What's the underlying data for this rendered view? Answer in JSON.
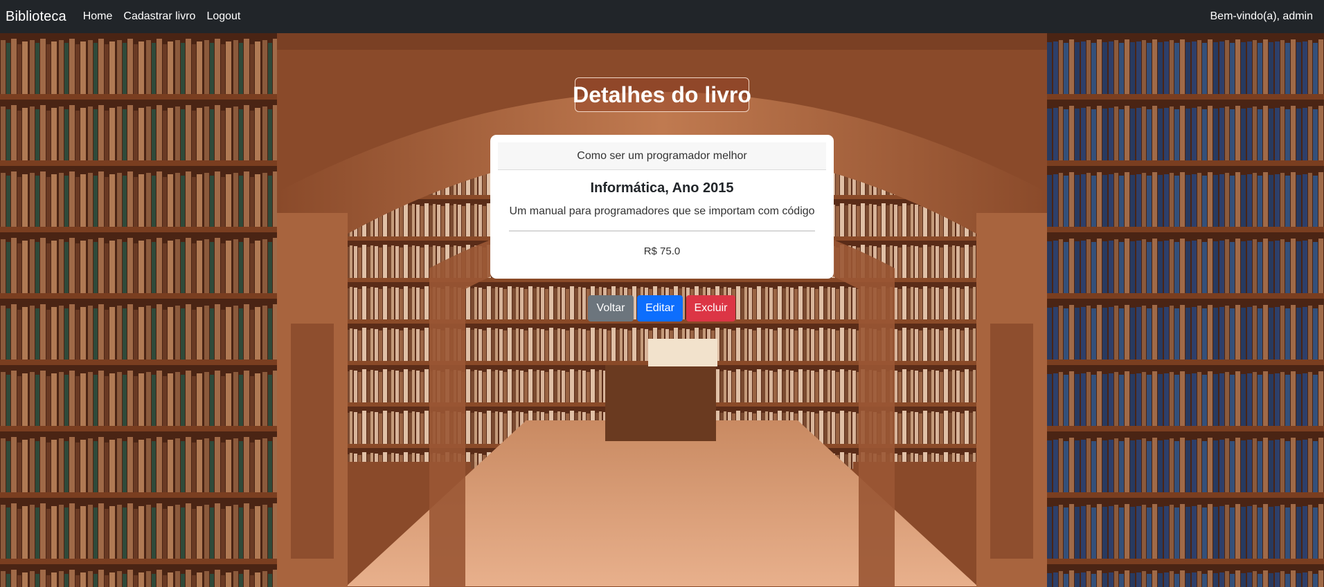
{
  "navbar": {
    "brand": "Biblioteca",
    "links": [
      "Home",
      "Cadastrar livro",
      "Logout"
    ],
    "welcome": "Bem-vindo(a), admin"
  },
  "page": {
    "title": "Detalhes do livro"
  },
  "book": {
    "title": "Como ser um programador melhor",
    "category_year": "Informática, Ano 2015",
    "description": "Um manual para programadores que se importam com código",
    "price": "R$ 75.0"
  },
  "actions": {
    "back": "Voltar",
    "edit": "Editar",
    "delete": "Excluir"
  },
  "colors": {
    "navbar": "#212529",
    "secondary": "#6c757d",
    "primary": "#0d6efd",
    "danger": "#dc3545"
  },
  "background": {
    "icon": "library-bookshelves-image"
  }
}
